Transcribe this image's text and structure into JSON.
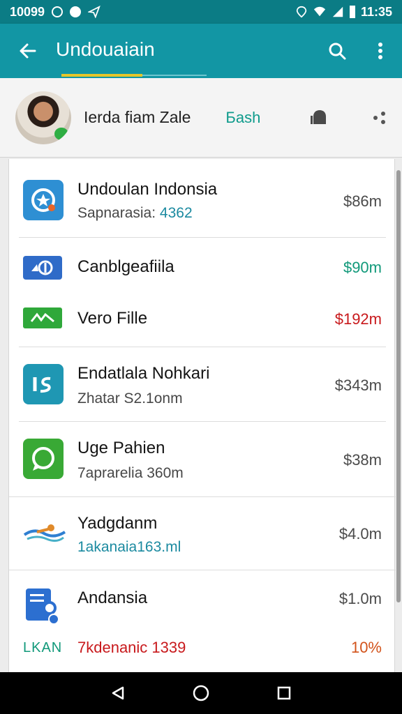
{
  "status_bar": {
    "time_left": "10099",
    "time_right": "11:35"
  },
  "app_bar": {
    "title": "Undouaiain",
    "back_icon": "arrow-left-icon",
    "search_icon": "search-icon",
    "menu_icon": "more-vertical-icon"
  },
  "profile": {
    "name": "Ierda fiam Zale",
    "action": "Бash",
    "avatar_icon": "avatar",
    "icon_1": "bell-icon",
    "icon_2": "share-icon"
  },
  "items": [
    {
      "title": "Undoulan Indonsia",
      "subtitle_prefix": "Sapnarasia:",
      "subtitle_value": "4362",
      "amount": "$86m",
      "icon": "star-app-icon",
      "icon_color": "#2e8fd3"
    },
    {
      "title": "Canblgeafiila",
      "subtitle": "",
      "amount": "$90m",
      "icon": "loop-app-icon",
      "icon_color": "#2f6bc8"
    },
    {
      "title": "Vero Fille",
      "subtitle": "",
      "amount": "$192m",
      "icon": "cash-app-icon",
      "icon_color": "#2fa83a"
    },
    {
      "title": "Endatlala Nohkari",
      "subtitle": "Zhatar S2.1onm",
      "amount": "$343m",
      "icon": "chart-app-icon",
      "icon_color": "#1f97b3"
    },
    {
      "title": "Uge Pahien",
      "subtitle": "7aprarelia 360m",
      "amount": "$38m",
      "icon": "chat-app-icon",
      "icon_color": "#39a935"
    },
    {
      "title": "Yadgdanm",
      "subtitle": "1akanaia163.ml",
      "amount": "$4.0m",
      "icon": "swimmer-icon",
      "icon_color": "#2f7fd1"
    },
    {
      "title": "Andansia",
      "subtitle": "",
      "amount": "$1.0m",
      "icon": "document-app-icon",
      "icon_color": "#2c6fd0"
    }
  ],
  "footer": {
    "logo": "LKAN",
    "label": "7kdenanic 1339",
    "percent": "10%"
  },
  "nav": {
    "back": "back-icon",
    "home": "home-icon",
    "recents": "recents-icon"
  }
}
